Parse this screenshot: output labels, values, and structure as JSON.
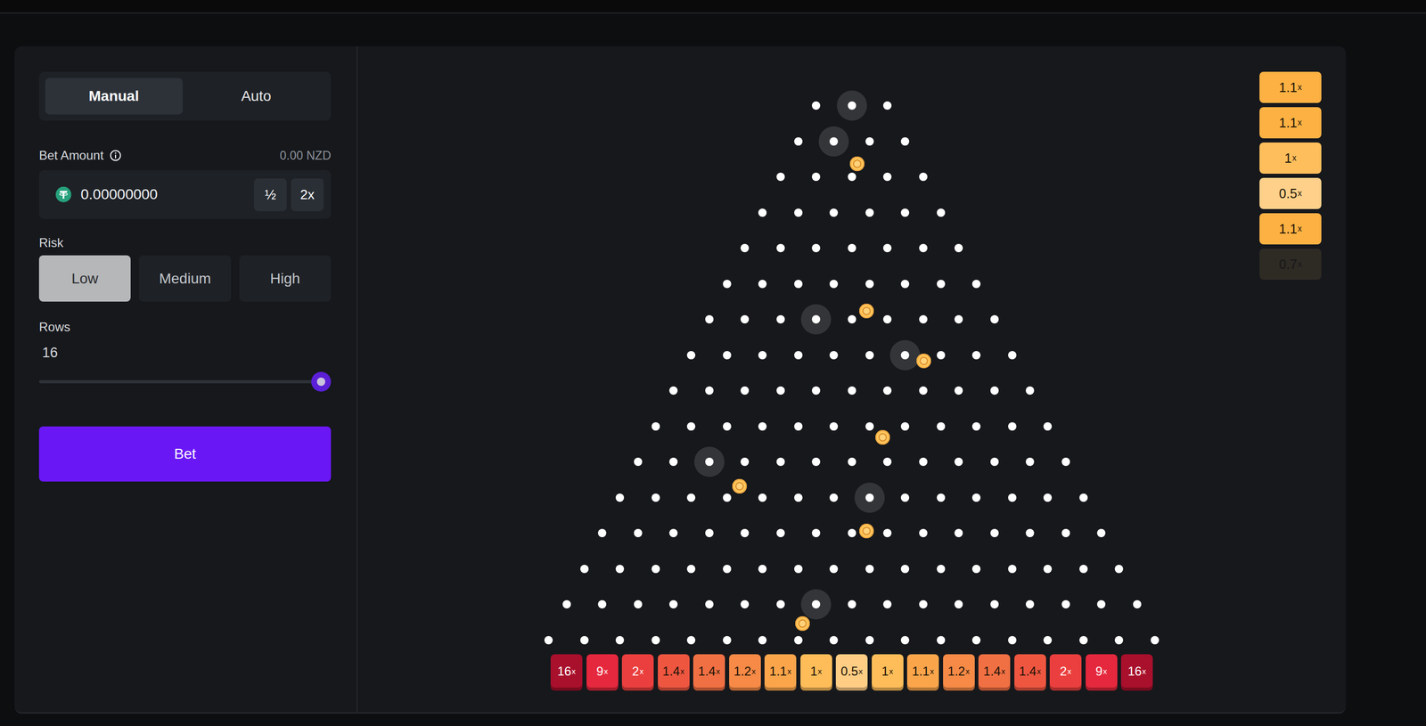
{
  "modes": [
    {
      "label": "Manual",
      "selected": true
    },
    {
      "label": "Auto",
      "selected": false
    }
  ],
  "bet": {
    "label": "Bet Amount",
    "fiat": "0.00 NZD",
    "value": "0.00000000",
    "buttons": [
      "½",
      "2x"
    ]
  },
  "risk": {
    "label": "Risk",
    "options": [
      {
        "label": "Low",
        "selected": true
      },
      {
        "label": "Medium",
        "selected": false
      },
      {
        "label": "High",
        "selected": false
      }
    ]
  },
  "rows": {
    "label": "Rows",
    "value": "16",
    "level": 1
  },
  "action": {
    "label": "Bet"
  },
  "board": {
    "lit_pegs": [
      {
        "row": 0,
        "index": 1
      },
      {
        "row": 1,
        "index": 1
      },
      {
        "row": 6,
        "index": 3
      },
      {
        "row": 7,
        "index": 6
      },
      {
        "row": 10,
        "index": 2
      },
      {
        "row": 11,
        "index": 7
      },
      {
        "row": 14,
        "index": 7
      }
    ],
    "balls": [
      {
        "x": 0.15,
        "y": 1.63
      },
      {
        "x": 0.41,
        "y": 5.77
      },
      {
        "x": 2.02,
        "y": 7.17
      },
      {
        "x": 0.87,
        "y": 9.31
      },
      {
        "x": -3.14,
        "y": 10.69
      },
      {
        "x": 0.41,
        "y": 11.94
      },
      {
        "x": -1.38,
        "y": 14.54
      }
    ]
  },
  "buckets": [
    {
      "value": "16",
      "unit": "x",
      "color": "#a8102c"
    },
    {
      "value": "9",
      "unit": "x",
      "color": "#e5283d"
    },
    {
      "value": "2",
      "unit": "x",
      "color": "#ea3f3e"
    },
    {
      "value": "1.4",
      "unit": "x",
      "color": "#ee5640"
    },
    {
      "value": "1.4",
      "unit": "x",
      "color": "#f17043"
    },
    {
      "value": "1.2",
      "unit": "x",
      "color": "#f68a46"
    },
    {
      "value": "1.1",
      "unit": "x",
      "color": "#fba54b"
    },
    {
      "value": "1",
      "unit": "x",
      "color": "#ffbd59"
    },
    {
      "value": "0.5",
      "unit": "x",
      "color": "#ffcd84"
    },
    {
      "value": "1",
      "unit": "x",
      "color": "#ffbd59"
    },
    {
      "value": "1.1",
      "unit": "x",
      "color": "#fba54b"
    },
    {
      "value": "1.2",
      "unit": "x",
      "color": "#f68a46"
    },
    {
      "value": "1.4",
      "unit": "x",
      "color": "#f17043"
    },
    {
      "value": "1.4",
      "unit": "x",
      "color": "#ee5640"
    },
    {
      "value": "2",
      "unit": "x",
      "color": "#ea3f3e"
    },
    {
      "value": "9",
      "unit": "x",
      "color": "#e5283d"
    },
    {
      "value": "16",
      "unit": "x",
      "color": "#a8102c"
    }
  ],
  "history": [
    {
      "value": "1.1",
      "unit": "x",
      "color": "#fdb143",
      "faded": false
    },
    {
      "value": "1.1",
      "unit": "x",
      "color": "#fdb143",
      "faded": false
    },
    {
      "value": "1",
      "unit": "x",
      "color": "#ffbe5c",
      "faded": false
    },
    {
      "value": "0.5",
      "unit": "x",
      "color": "#ffd08a",
      "faded": false
    },
    {
      "value": "1.1",
      "unit": "x",
      "color": "#fdb143",
      "faded": false
    },
    {
      "value": "0.7",
      "unit": "x",
      "color": "#ffc56f",
      "faded": true
    }
  ]
}
